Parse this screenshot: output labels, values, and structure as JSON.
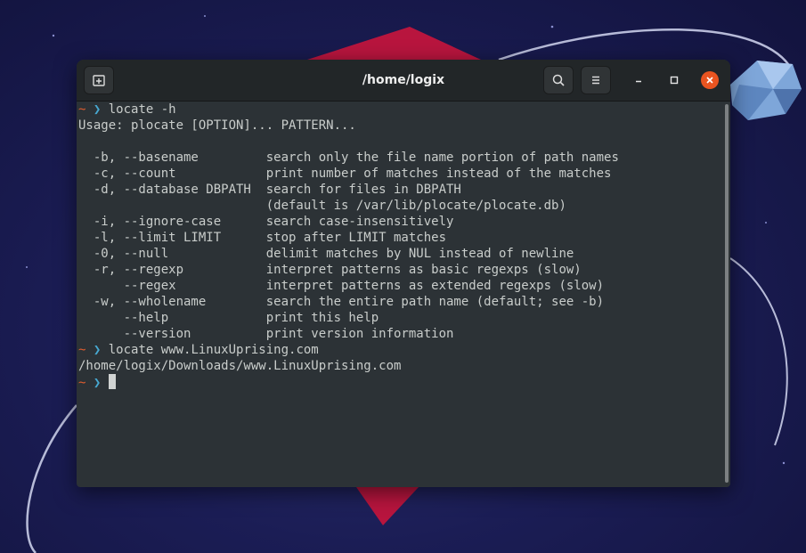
{
  "window": {
    "title": "/home/logix",
    "new_tab_icon": "new-tab-icon",
    "search_icon": "search-icon",
    "menu_icon": "hamburger-menu-icon",
    "minimize_icon": "minimize-icon",
    "maximize_icon": "maximize-icon",
    "close_icon": "close-icon",
    "close_color": "#e95420"
  },
  "terminal": {
    "prompt_tilde": "~",
    "prompt_chevron": "❯",
    "lines": [
      {
        "type": "prompt",
        "cmd": "locate -h"
      },
      {
        "type": "output",
        "text": "Usage: plocate [OPTION]... PATTERN..."
      },
      {
        "type": "output",
        "text": ""
      },
      {
        "type": "output",
        "text": "  -b, --basename         search only the file name portion of path names"
      },
      {
        "type": "output",
        "text": "  -c, --count            print number of matches instead of the matches"
      },
      {
        "type": "output",
        "text": "  -d, --database DBPATH  search for files in DBPATH"
      },
      {
        "type": "output",
        "text": "                         (default is /var/lib/plocate/plocate.db)"
      },
      {
        "type": "output",
        "text": "  -i, --ignore-case      search case-insensitively"
      },
      {
        "type": "output",
        "text": "  -l, --limit LIMIT      stop after LIMIT matches"
      },
      {
        "type": "output",
        "text": "  -0, --null             delimit matches by NUL instead of newline"
      },
      {
        "type": "output",
        "text": "  -r, --regexp           interpret patterns as basic regexps (slow)"
      },
      {
        "type": "output",
        "text": "      --regex            interpret patterns as extended regexps (slow)"
      },
      {
        "type": "output",
        "text": "  -w, --wholename        search the entire path name (default; see -b)"
      },
      {
        "type": "output",
        "text": "      --help             print this help"
      },
      {
        "type": "output",
        "text": "      --version          print version information"
      },
      {
        "type": "prompt",
        "cmd": "locate www.LinuxUprising.com"
      },
      {
        "type": "output",
        "text": "/home/logix/Downloads/www.LinuxUprising.com"
      },
      {
        "type": "prompt",
        "cmd": ""
      }
    ]
  },
  "colors": {
    "prompt_tilde": "#e05d2f",
    "prompt_chevron": "#47a8d1",
    "terminal_bg": "#2c3236",
    "terminal_fg": "#c9cdcb"
  }
}
